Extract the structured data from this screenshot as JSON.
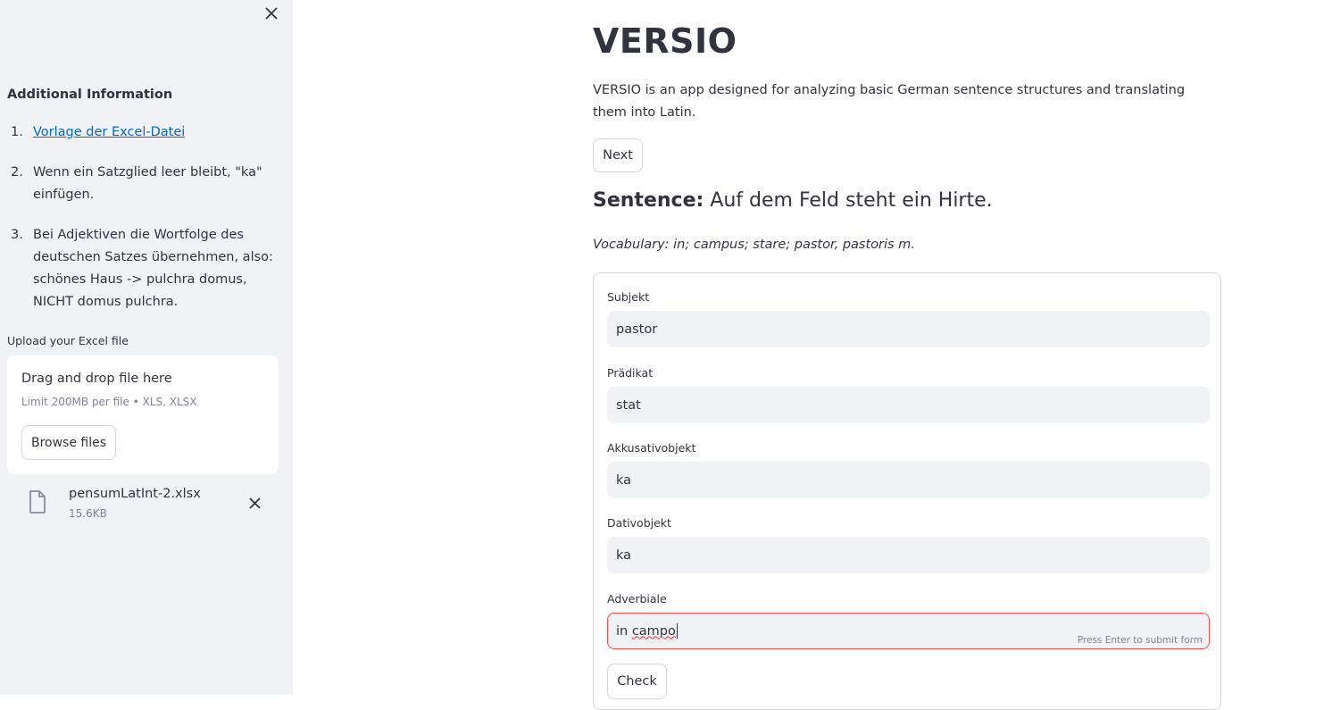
{
  "sidebar": {
    "heading": "Additional Information",
    "items": [
      {
        "num": "1.",
        "text": "Vorlage der Excel-Datei",
        "is_link": true
      },
      {
        "num": "2.",
        "text": "Wenn ein Satzglied leer bleibt, \"ka\" einfügen.",
        "is_link": false
      },
      {
        "num": "3.",
        "text": "Bei Adjektiven die Wortfolge des deutschen Satzes übernehmen, also: schönes Haus -> pulchra domus, NICHT domus pulchra.",
        "is_link": false
      }
    ],
    "upload_label": "Upload your Excel file",
    "dropzone": {
      "title": "Drag and drop file here",
      "limit": "Limit 200MB per file • XLS, XLSX",
      "browse_label": "Browse files"
    },
    "file": {
      "name": "pensumLatInt-2.xlsx",
      "size": "15.6KB"
    }
  },
  "main": {
    "title": "VERSIO",
    "description": "VERSIO is an app designed for analyzing basic German sentence structures and translating them into Latin.",
    "next_label": "Next",
    "sentence_label": "Sentence:",
    "sentence_text": " Auf dem Feld steht ein Hirte.",
    "vocabulary": "Vocabulary: in; campus; stare; pastor, pastoris m.",
    "form": {
      "fields": [
        {
          "label": "Subjekt",
          "value": "pastor"
        },
        {
          "label": "Prädikat",
          "value": "stat"
        },
        {
          "label": "Akkusativobjekt",
          "value": "ka"
        },
        {
          "label": "Dativobjekt",
          "value": "ka"
        },
        {
          "label": "Adverbiale",
          "value_plain": "in ",
          "value_misspelled": "campo"
        }
      ],
      "hint": "Press Enter to submit form",
      "check_label": "Check"
    }
  },
  "colors": {
    "sidebar_bg": "#f0f2f6",
    "link": "#0068c9",
    "focus_border": "#ff4b4b",
    "input_bg": "#f0f2f6"
  },
  "icons": [
    "close-icon",
    "file-icon",
    "remove-file-icon"
  ]
}
